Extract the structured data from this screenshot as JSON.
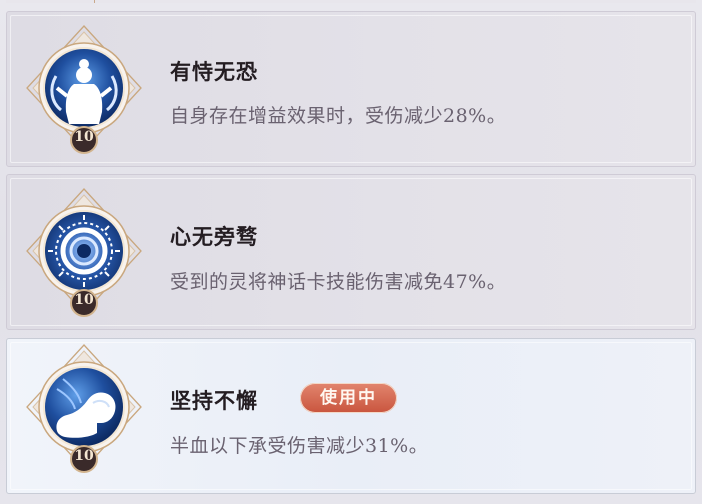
{
  "skills": [
    {
      "name": "有恃无恐",
      "description": "自身存在增益效果时，受伤减少28%。",
      "level": "10",
      "icon": "figure-silhouette-icon",
      "active": false
    },
    {
      "name": "心无旁骛",
      "description": "受到的灵将神话卡技能伤害减免47%。",
      "level": "10",
      "icon": "radiant-ring-icon",
      "active": false
    },
    {
      "name": "坚持不懈",
      "description": "半血以下承受伤害减少31%。",
      "level": "10",
      "icon": "flexed-arm-icon",
      "active": true,
      "status_label": "使用中"
    }
  ],
  "colors": {
    "badge_blue_dark": "#0d2a63",
    "badge_blue_light": "#5f9ee8",
    "frame_gold": "#c9a77e",
    "level_circle": "#3a2a2a",
    "in_use_red": "#c9553e"
  }
}
